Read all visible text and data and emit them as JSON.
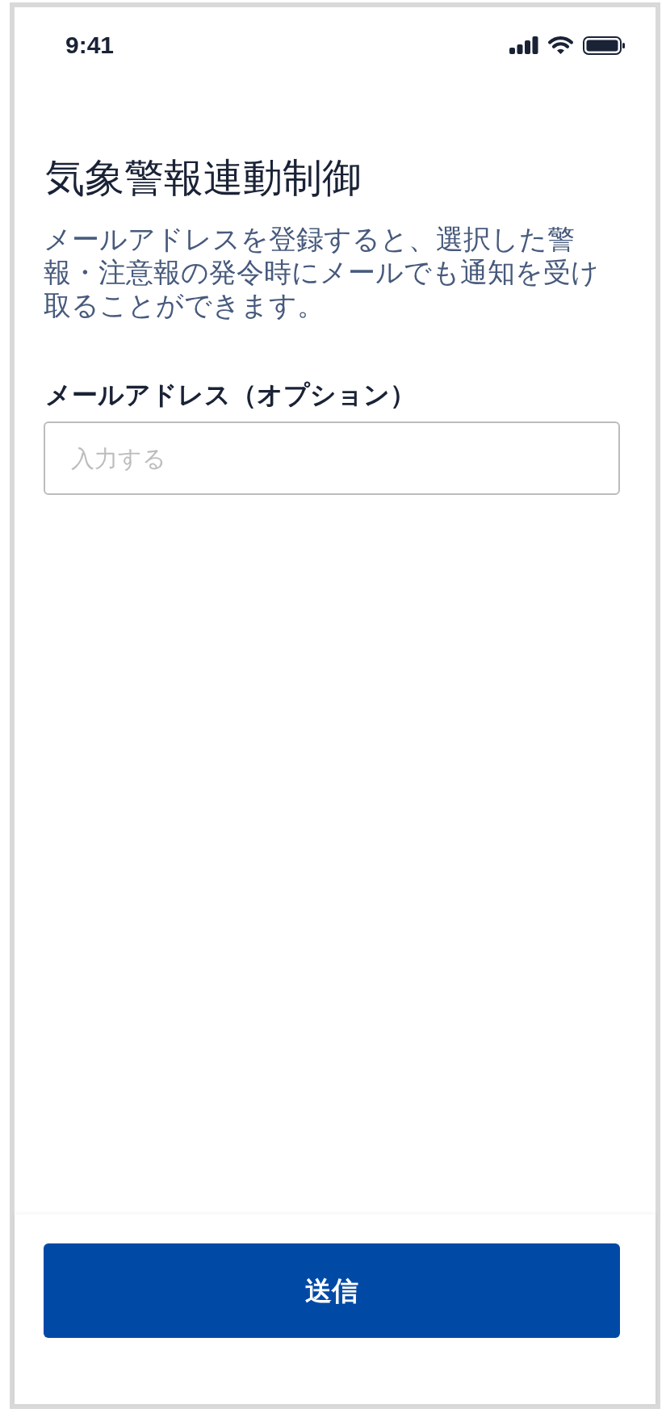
{
  "status_bar": {
    "time": "9:41"
  },
  "title": "気象警報連動制御",
  "description": "メールアドレスを登録すると、選択した警報・注意報の発令時にメールでも通知を受け取ることができます。",
  "email_field": {
    "label": "メールアドレス（オプション）",
    "placeholder": "入力する"
  },
  "submit_button": {
    "label": "送信"
  }
}
